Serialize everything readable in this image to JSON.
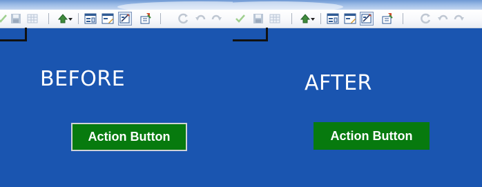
{
  "colors": {
    "background": "#1a55b0",
    "button_green": "#077a0e",
    "button_border_before": "#cfd3d6",
    "toolbar_bg": "#f7f8fb"
  },
  "toolbar": {
    "icons": [
      "check-icon",
      "save-icon",
      "grid-icon",
      "up-arrow-icon",
      "form-icon",
      "form-edit-icon",
      "design-mode-icon",
      "properties-icon",
      "refresh-icon",
      "undo-icon",
      "redo-icon"
    ],
    "selected_icon": "design-mode-icon"
  },
  "panels": [
    {
      "heading": "BEFORE",
      "button_label": "Action Button"
    },
    {
      "heading": "AFTER",
      "button_label": "Action Button"
    }
  ]
}
